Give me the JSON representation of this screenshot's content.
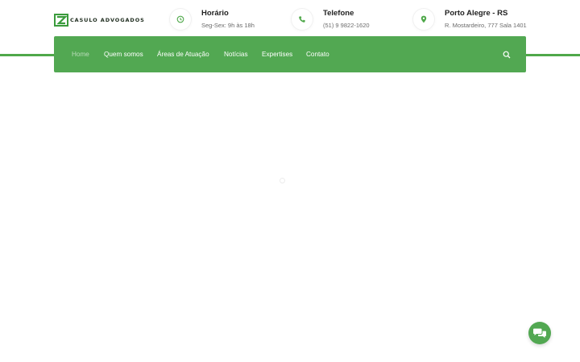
{
  "header": {
    "logo_text": "CASULO ADVOGADOS",
    "info": [
      {
        "title": "Horário",
        "subtitle": "Seg-Sex: 9h às 18h",
        "icon": "clock-icon"
      },
      {
        "title": "Telefone",
        "subtitle": "(51) 9 9822-1620",
        "icon": "phone-icon"
      },
      {
        "title": "Porto Alegre - RS",
        "subtitle": "R. Mostardeiro, 777 Sala 1401",
        "icon": "map-pin-icon"
      }
    ]
  },
  "nav": {
    "items": [
      {
        "label": "Home",
        "active": true
      },
      {
        "label": "Quem somos"
      },
      {
        "label": "Áreas de Atuação"
      },
      {
        "label": "Notícias"
      },
      {
        "label": "Expertises"
      },
      {
        "label": "Contato"
      }
    ],
    "search_icon": "search-icon"
  },
  "chat": {
    "icon": "chat-bubbles-icon"
  },
  "colors": {
    "brand_green": "#52a852",
    "line_green": "#4fa84a",
    "text_dark": "#222222",
    "text_muted": "#6b6b6b"
  }
}
